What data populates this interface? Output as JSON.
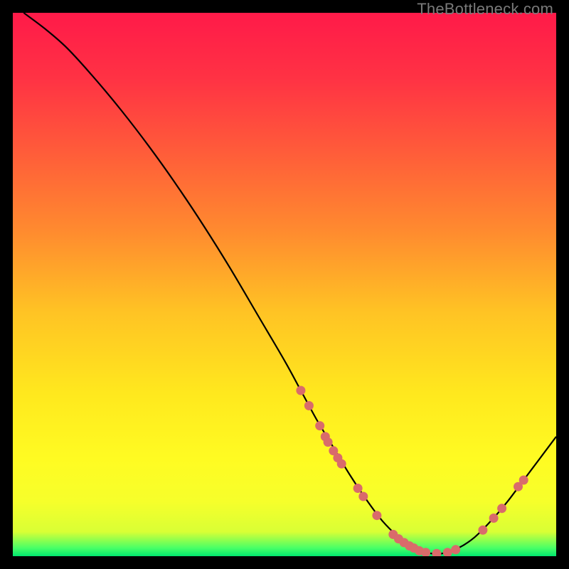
{
  "watermark": "TheBottleneck.com",
  "gradient": {
    "stops": [
      {
        "offset": 0.0,
        "color": "#ff1a49"
      },
      {
        "offset": 0.12,
        "color": "#ff3244"
      },
      {
        "offset": 0.25,
        "color": "#ff5a3a"
      },
      {
        "offset": 0.4,
        "color": "#ff8a2f"
      },
      {
        "offset": 0.55,
        "color": "#ffc324"
      },
      {
        "offset": 0.7,
        "color": "#ffe81e"
      },
      {
        "offset": 0.82,
        "color": "#fffb22"
      },
      {
        "offset": 0.9,
        "color": "#f6ff2b"
      },
      {
        "offset": 0.955,
        "color": "#d9ff35"
      },
      {
        "offset": 0.985,
        "color": "#48ff66"
      },
      {
        "offset": 1.0,
        "color": "#00e66e"
      }
    ]
  },
  "chart_data": {
    "type": "line",
    "title": "",
    "xlabel": "",
    "ylabel": "",
    "xlim": [
      0,
      100
    ],
    "ylim": [
      0,
      100
    ],
    "series": [
      {
        "name": "curve",
        "x": [
          2,
          6,
          10,
          15,
          20,
          25,
          30,
          35,
          40,
          45,
          50,
          53,
          56,
          59,
          62,
          65,
          68,
          71,
          73,
          75,
          77,
          79,
          82,
          85,
          88,
          91,
          94,
          97,
          100
        ],
        "y": [
          100,
          97,
          93.5,
          88,
          82,
          75.5,
          68.5,
          61,
          53,
          44.5,
          36,
          30.5,
          25,
          20,
          15,
          10.5,
          6.5,
          3.5,
          2,
          1,
          0.5,
          0.5,
          1.5,
          3.5,
          6.5,
          10,
          14,
          18,
          22
        ]
      }
    ],
    "markers": {
      "color": "#d96b6b",
      "radius": 6.5,
      "points": [
        {
          "x": 53.0,
          "y": 30.5
        },
        {
          "x": 54.5,
          "y": 27.7
        },
        {
          "x": 56.5,
          "y": 24.0
        },
        {
          "x": 57.5,
          "y": 22.0
        },
        {
          "x": 58.0,
          "y": 21.0
        },
        {
          "x": 59.0,
          "y": 19.4
        },
        {
          "x": 59.8,
          "y": 18.1
        },
        {
          "x": 60.5,
          "y": 17.0
        },
        {
          "x": 63.5,
          "y": 12.5
        },
        {
          "x": 64.5,
          "y": 11.0
        },
        {
          "x": 67.0,
          "y": 7.5
        },
        {
          "x": 70.0,
          "y": 4.0
        },
        {
          "x": 71.0,
          "y": 3.2
        },
        {
          "x": 72.0,
          "y": 2.5
        },
        {
          "x": 73.0,
          "y": 1.9
        },
        {
          "x": 73.8,
          "y": 1.5
        },
        {
          "x": 74.8,
          "y": 1.0
        },
        {
          "x": 76.0,
          "y": 0.7
        },
        {
          "x": 78.0,
          "y": 0.5
        },
        {
          "x": 80.0,
          "y": 0.7
        },
        {
          "x": 81.5,
          "y": 1.2
        },
        {
          "x": 86.5,
          "y": 4.8
        },
        {
          "x": 88.5,
          "y": 7.0
        },
        {
          "x": 90.0,
          "y": 8.8
        },
        {
          "x": 93.0,
          "y": 12.8
        },
        {
          "x": 94.0,
          "y": 14.0
        }
      ]
    }
  }
}
